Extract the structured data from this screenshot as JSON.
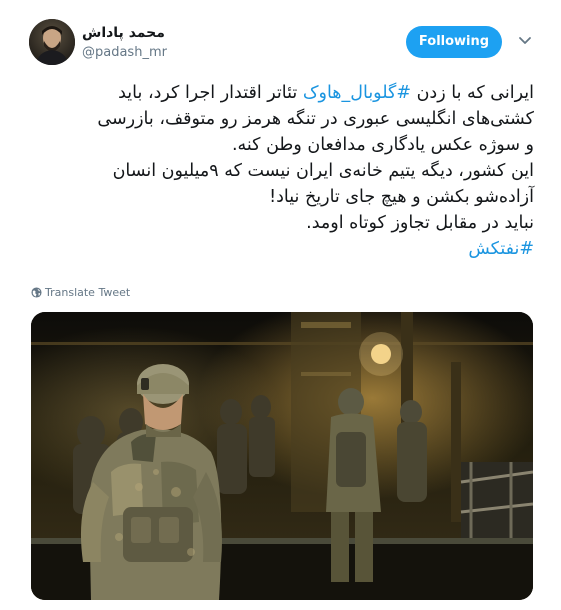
{
  "user": {
    "display_name": "محمد پاداش",
    "handle": "@padash_mr"
  },
  "follow_button": {
    "label": "Following"
  },
  "menu": {
    "icon": "chevron-down-icon"
  },
  "tweet": {
    "segments": {
      "l1_a": "ایرانی که با زدن ",
      "l1_tag": "#گلوبال_هاوک",
      "l1_b": " تئاتر اقتدار اجرا کرد، باید",
      "l2": "کشتی‌های انگلیسی عبوری در تنگه هرمز رو متوقف، بازرسی",
      "l3": "و سوژه عکس یادگاری مدافعان وطن کنه.",
      "l4": "این کشور، دیگه یتیم خانه‌ی ایران نیست که ۹میلیون انسان",
      "l5": "آزاده‌شو بکشن و هیچ جای تاریخ نیاد!",
      "l6": "نباید در مقابل تجاوز کوتاه اومد.",
      "l7_tag": "#نفتکش"
    }
  },
  "translate": {
    "label": "Translate Tweet",
    "icon": "globe-icon"
  },
  "colors": {
    "accent": "#1da1f2",
    "hashtag": "#1b95e0",
    "secondary_text": "#657786"
  }
}
